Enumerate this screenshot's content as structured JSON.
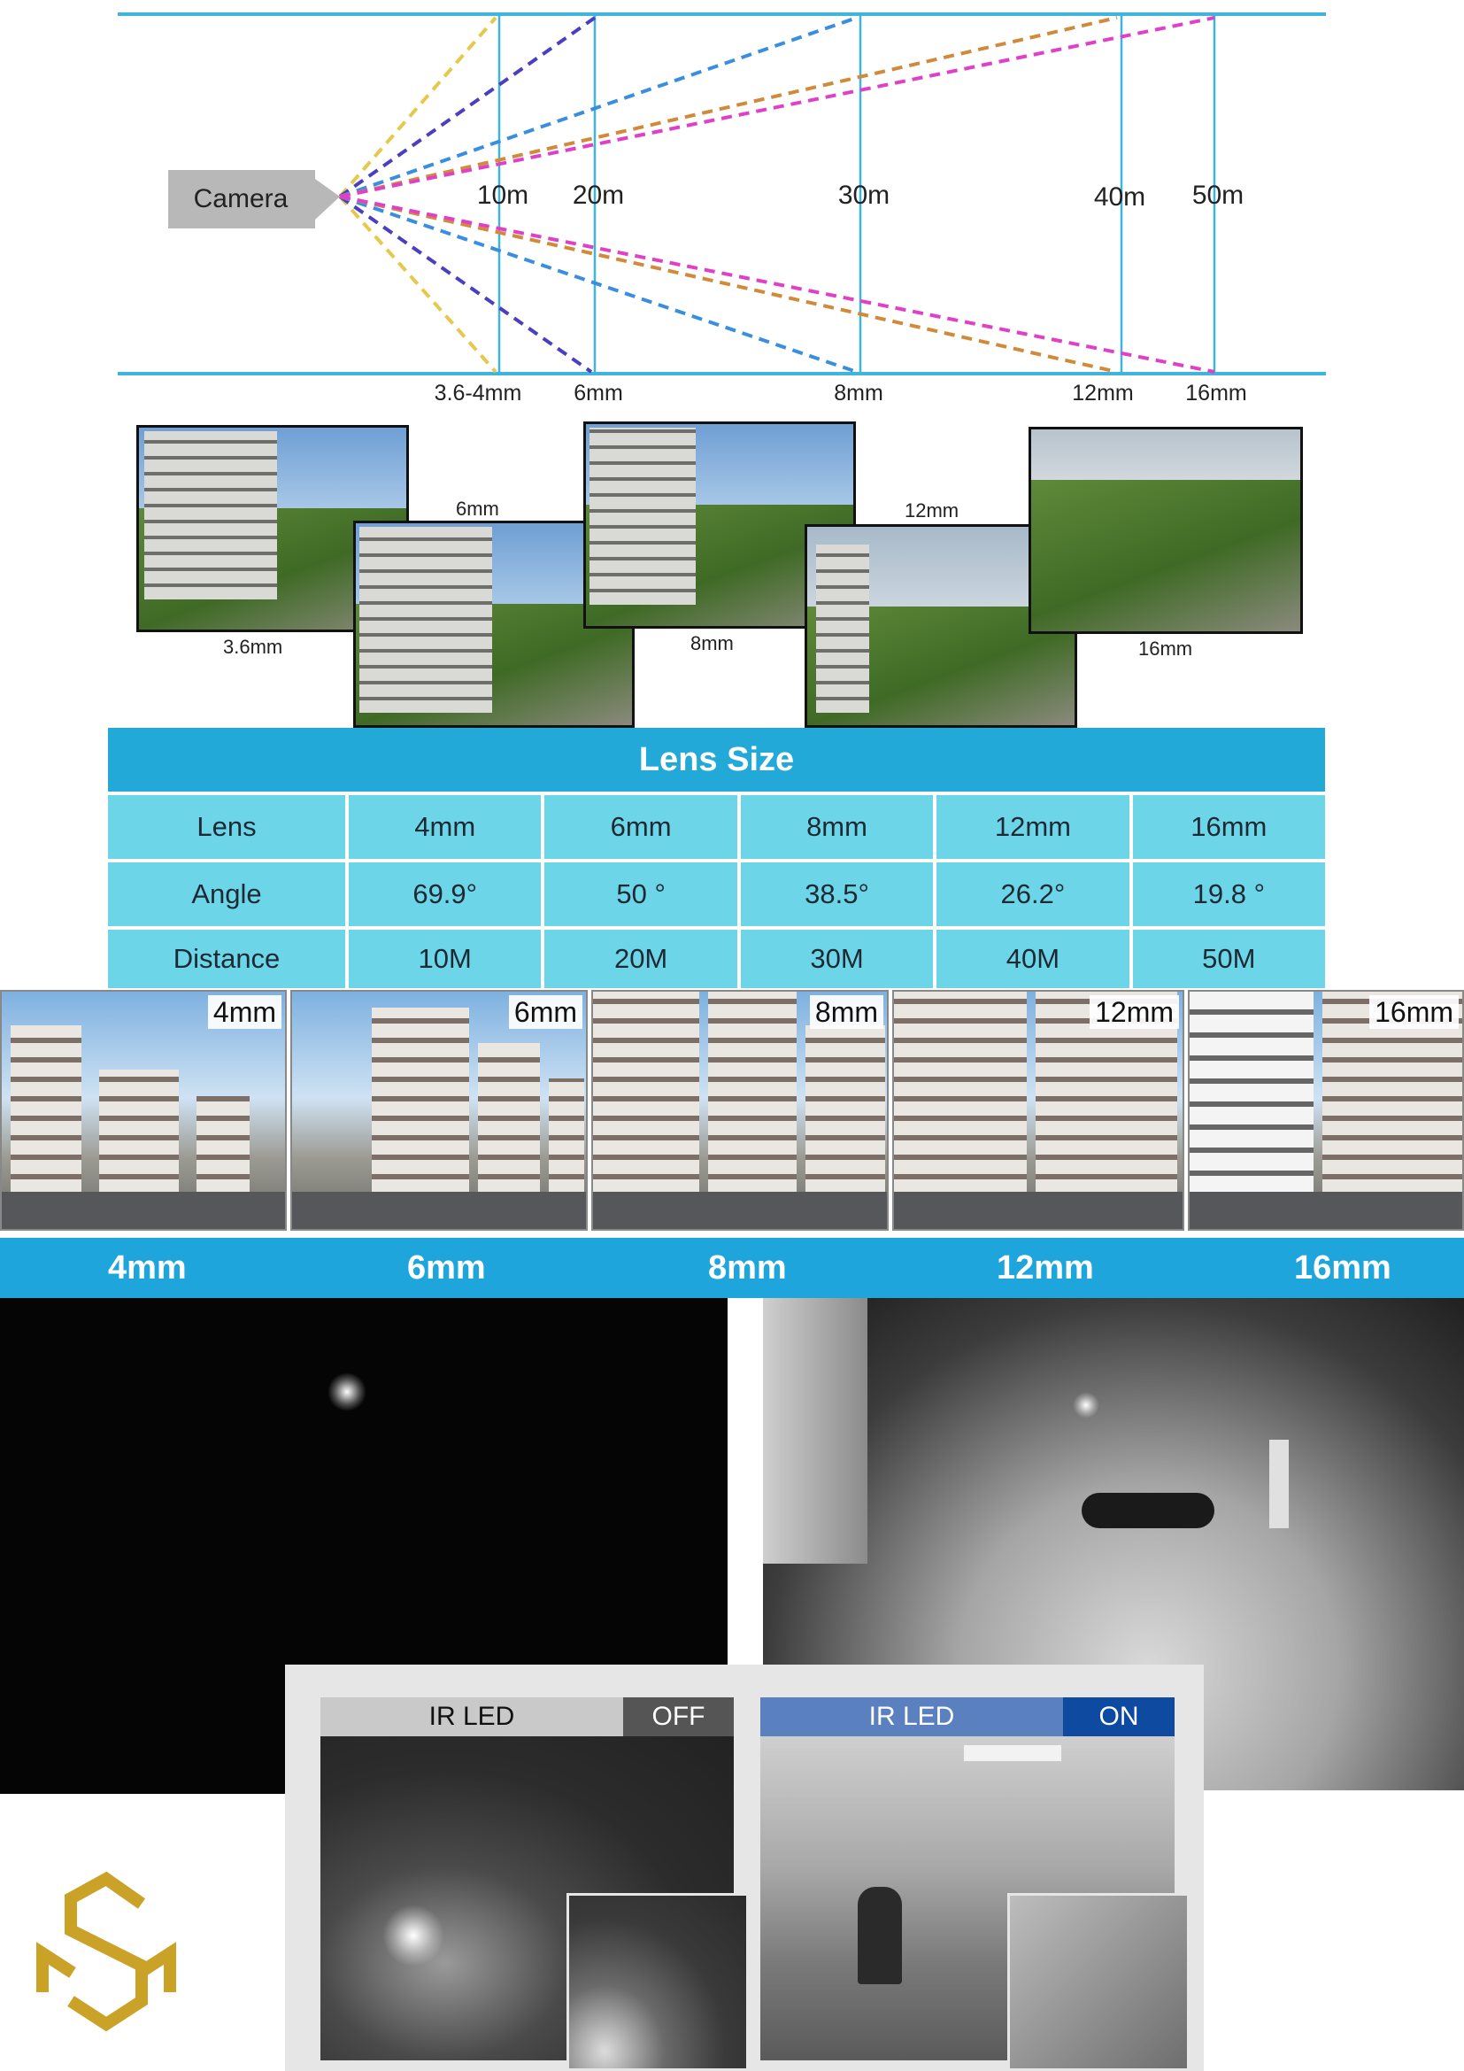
{
  "fov_diagram": {
    "camera_label": "Camera",
    "distances": [
      "10m",
      "20m",
      "30m",
      "40m",
      "50m"
    ],
    "lenses": [
      "3.6-4mm",
      "6mm",
      "8mm",
      "12mm",
      "16mm"
    ],
    "colors": {
      "guide": "#3fb4dc",
      "lens_3_6": "#e6c84a",
      "lens_6": "#4a3fbf",
      "lens_8": "#3a8ee0",
      "lens_12": "#d08a3a",
      "lens_16": "#e040c8"
    }
  },
  "sample_photos": {
    "captions": [
      "3.6mm",
      "6mm",
      "8mm",
      "12mm",
      "16mm"
    ]
  },
  "lens_table": {
    "title": "Lens Size",
    "rows": [
      {
        "label": "Lens",
        "values": [
          "4mm",
          "6mm",
          "8mm",
          "12mm",
          "16mm"
        ]
      },
      {
        "label": "Angle",
        "values": [
          "69.9°",
          "50 °",
          "38.5°",
          "26.2°",
          "19.8 °"
        ]
      },
      {
        "label": "Distance",
        "values": [
          "10M",
          "20M",
          "30M",
          "40M",
          "50M"
        ]
      }
    ],
    "colors": {
      "header": "#22a9d8",
      "row": "#6cd6e8"
    }
  },
  "focal_strip": {
    "tags": [
      "4mm",
      "6mm",
      "8mm",
      "12mm",
      "16mm"
    ],
    "bar_labels": [
      "4mm",
      "6mm",
      "8mm",
      "12mm",
      "16mm"
    ],
    "bar_color": "#1ea6dc"
  },
  "ir_panel": {
    "left": {
      "label": "IR LED",
      "state": "OFF",
      "state_color": "#555555"
    },
    "right": {
      "label": "IR LED",
      "state": "ON",
      "state_color": "#0d4aa0"
    }
  },
  "logo": {
    "icon": "sm-monogram-logo",
    "color": "#c9a227"
  }
}
